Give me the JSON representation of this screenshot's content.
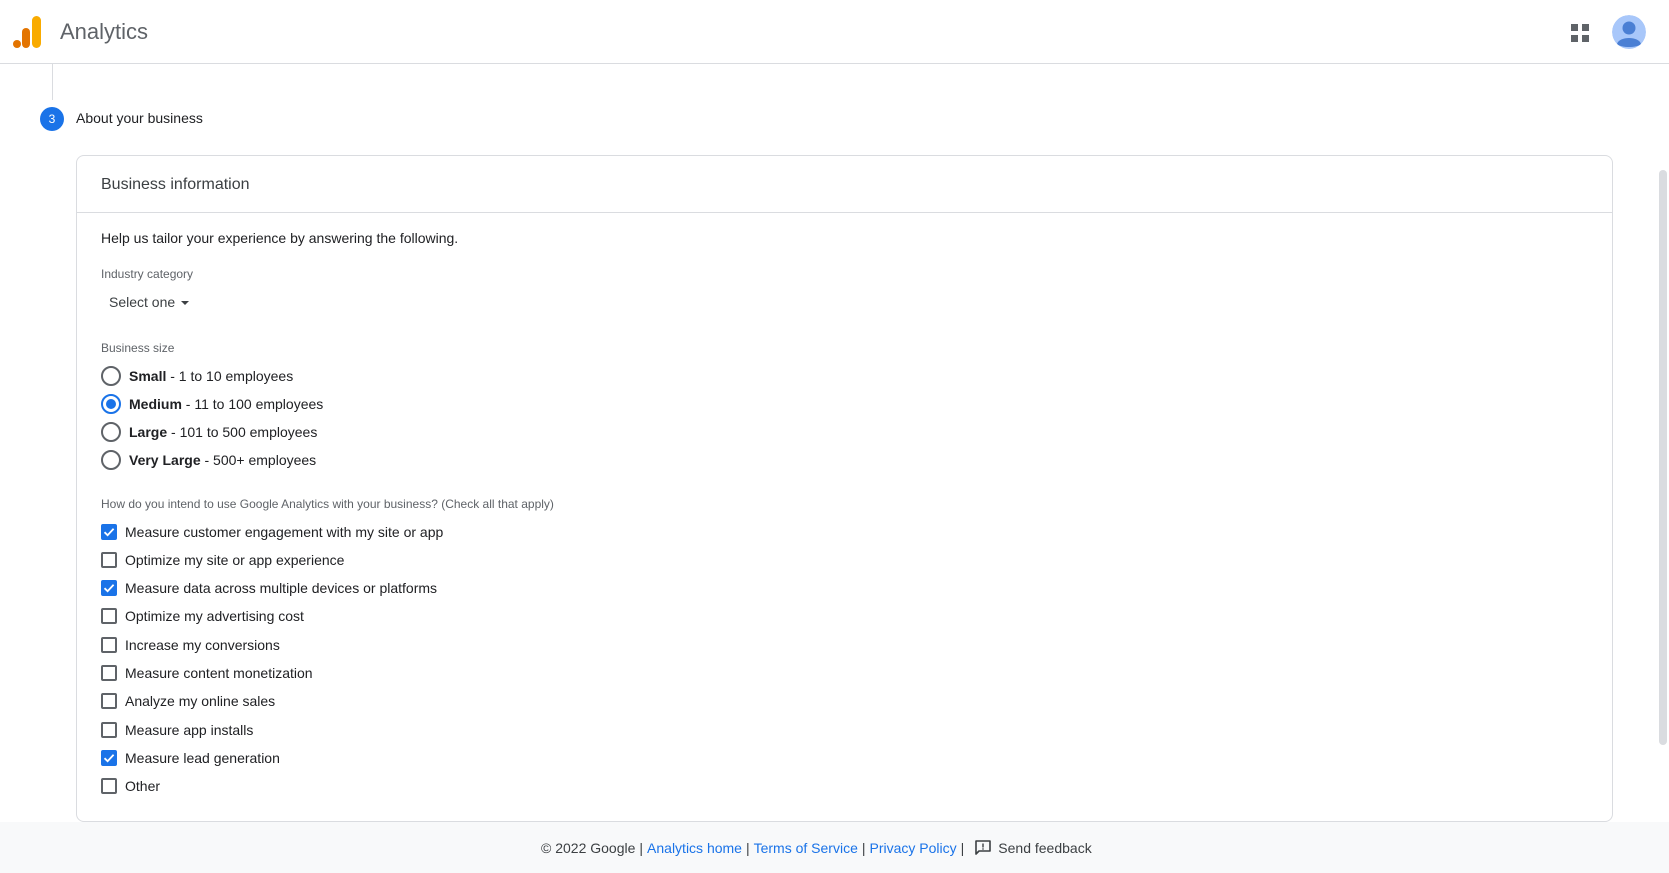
{
  "header": {
    "app_title": "Analytics"
  },
  "stepper": {
    "step_number": "3",
    "step_title": "About your business"
  },
  "card": {
    "title": "Business information",
    "intro": "Help us tailor your experience by answering the following.",
    "industry": {
      "label": "Industry category",
      "selected": "Select one"
    },
    "business_size": {
      "label": "Business size",
      "options": [
        {
          "bold": "Small",
          "rest": " - 1 to 10 employees",
          "checked": false
        },
        {
          "bold": "Medium",
          "rest": " - 11 to 100 employees",
          "checked": true
        },
        {
          "bold": "Large",
          "rest": " - 101 to 500 employees",
          "checked": false
        },
        {
          "bold": "Very Large",
          "rest": " - 500+ employees",
          "checked": false
        }
      ]
    },
    "usage": {
      "label": "How do you intend to use Google Analytics with your business? (Check all that apply)",
      "options": [
        {
          "label": "Measure customer engagement with my site or app",
          "checked": true
        },
        {
          "label": "Optimize my site or app experience",
          "checked": false
        },
        {
          "label": "Measure data across multiple devices or platforms",
          "checked": true
        },
        {
          "label": "Optimize my advertising cost",
          "checked": false
        },
        {
          "label": "Increase my conversions",
          "checked": false
        },
        {
          "label": "Measure content monetization",
          "checked": false
        },
        {
          "label": "Analyze my online sales",
          "checked": false
        },
        {
          "label": "Measure app installs",
          "checked": false
        },
        {
          "label": "Measure lead generation",
          "checked": true
        },
        {
          "label": "Other",
          "checked": false
        }
      ]
    }
  },
  "footer": {
    "copyright": "© 2022 Google",
    "analytics_home": "Analytics home",
    "terms": "Terms of Service",
    "privacy": "Privacy Policy",
    "feedback": "Send feedback"
  },
  "colors": {
    "accent": "#1a73e8",
    "logo_dark": "#e37400",
    "logo_light": "#f9ab00",
    "avatar_bg": "#a8c7fa",
    "avatar_fg": "#4a7fd4"
  }
}
